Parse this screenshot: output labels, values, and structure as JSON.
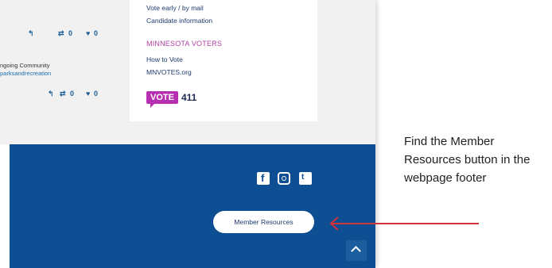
{
  "tweets": [
    {
      "reply_icon": "reply-icon",
      "retweet_icon": "retweet-icon",
      "retweet_count": "0",
      "like_icon": "heart-icon",
      "like_count": "0"
    },
    {
      "reply_icon": "reply-icon",
      "retweet_icon": "retweet-icon",
      "retweet_count": "0",
      "like_icon": "heart-icon",
      "like_count": "0"
    }
  ],
  "tweet_snippet": {
    "text": "ngoing Community",
    "link": "parksandrecreation"
  },
  "card": {
    "line1": "Vote early / by mail",
    "line2": "Candidate information",
    "heading": "MINNESOTA VOTERS",
    "line3": "How to Vote",
    "line4": "MNVOTES.org",
    "vote_badge": "VOTE",
    "vote_number": "411"
  },
  "footer": {
    "social_icons": [
      "facebook-icon",
      "instagram-icon",
      "twitter-icon"
    ],
    "member_button": "Member Resources",
    "back_to_top_icon": "chevron-up-icon"
  },
  "instruction": "Find the Member Resources button in the webpage footer",
  "colors": {
    "footer": "#0e4e92",
    "accent": "#b52fb0",
    "arrow": "#d0333b"
  }
}
